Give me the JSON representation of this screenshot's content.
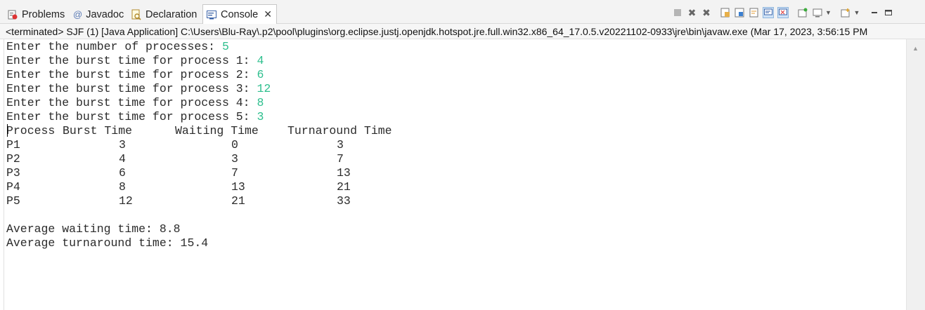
{
  "tabs": [
    {
      "label": "Problems",
      "icon": "problems-icon"
    },
    {
      "label": "Javadoc",
      "icon": "at-sign-icon"
    },
    {
      "label": "Declaration",
      "icon": "declaration-icon"
    },
    {
      "label": "Console",
      "icon": "console-icon",
      "active": true
    }
  ],
  "process_line": "<terminated> SJF (1) [Java Application] C:\\Users\\Blu-Ray\\.p2\\pool\\plugins\\org.eclipse.justj.openjdk.hotspot.jre.full.win32.x86_64_17.0.5.v20221102-0933\\jre\\bin\\javaw.exe  (Mar 17, 2023, 3:56:15 PM",
  "toolbar_icons": [
    "terminate-icon",
    "remove-launch-icon",
    "remove-all-terminated-icon",
    "clear-console-icon",
    "scroll-lock-icon",
    "word-wrap-icon",
    "show-stdout-icon",
    "show-stderr-icon",
    "pin-console-icon",
    "display-console-icon",
    "dropdown-chevron-icon",
    "new-console-icon",
    "dropdown-chevron-icon",
    "minimize-icon",
    "maximize-icon"
  ],
  "console": {
    "prompts": [
      {
        "text": "Enter the number of processes: ",
        "input": "5"
      },
      {
        "text": "Enter the burst time for process 1: ",
        "input": "4"
      },
      {
        "text": "Enter the burst time for process 2: ",
        "input": "6"
      },
      {
        "text": "Enter the burst time for process 3: ",
        "input": "12"
      },
      {
        "text": "Enter the burst time for process 4: ",
        "input": "8"
      },
      {
        "text": "Enter the burst time for process 5: ",
        "input": "3"
      }
    ],
    "table_headers": [
      "Process",
      "Burst Time",
      "Waiting Time",
      "Turnaround Time"
    ],
    "rows": [
      [
        "P1",
        "3",
        "0",
        "3"
      ],
      [
        "P2",
        "4",
        "3",
        "7"
      ],
      [
        "P3",
        "6",
        "7",
        "13"
      ],
      [
        "P4",
        "8",
        "13",
        "21"
      ],
      [
        "P5",
        "12",
        "21",
        "33"
      ]
    ],
    "avg_waiting": "Average waiting time: 8.8",
    "avg_turnaround": "Average turnaround time: 15.4"
  },
  "colors": {
    "user_input": "#2ebf8e",
    "stdout": "#2b2b2b",
    "tab_bar": "#f3f3f3"
  }
}
